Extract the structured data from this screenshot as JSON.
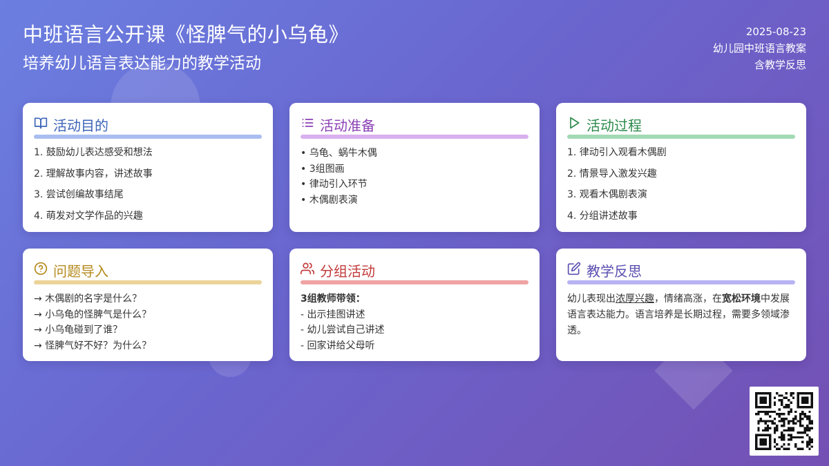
{
  "header": {
    "title": "中班语言公开课《怪脾气的小乌龟》",
    "subtitle": "培养幼儿语言表达能力的教学活动"
  },
  "meta": {
    "date": "2025-08-23",
    "line2": "幼儿园中班语言教案",
    "line3": "含教学反思"
  },
  "colors": {
    "goal": "#3c63b8",
    "prep": "#8a3fb5",
    "process": "#2a8a4a",
    "question": "#b58a1e",
    "group": "#c23a3a",
    "reflect": "#5a4fb0"
  },
  "cards": {
    "goal": {
      "icon": "book-open-icon",
      "title": "活动目的",
      "items": [
        "1. 鼓励幼儿表达感受和想法",
        "2. 理解故事内容，讲述故事",
        "3. 尝试创编故事结尾",
        "4. 萌发对文学作品的兴趣"
      ]
    },
    "prep": {
      "icon": "list-icon",
      "title": "活动准备",
      "items": [
        "• 乌龟、蜗牛木偶",
        "• 3组图画",
        "• 律动引入环节",
        "• 木偶剧表演"
      ]
    },
    "process": {
      "icon": "play-icon",
      "title": "活动过程",
      "items": [
        "1. 律动引入观看木偶剧",
        "2. 情景导入激发兴趣",
        "3. 观看木偶剧表演",
        "4. 分组讲述故事"
      ]
    },
    "question": {
      "icon": "question-circle-icon",
      "title": "问题导入",
      "items": [
        "→ 木偶剧的名字是什么？",
        "→ 小乌龟的怪脾气是什么？",
        "→ 小乌龟碰到了谁？",
        "→ 怪脾气好不好？为什么？"
      ]
    },
    "group": {
      "icon": "users-icon",
      "title": "分组活动",
      "lead": "3组教师带领：",
      "items": [
        "- 出示挂图讲述",
        "- 幼儿尝试自己讲述",
        "- 回家讲给父母听"
      ]
    },
    "reflect": {
      "icon": "edit-icon",
      "title": "教学反思",
      "text1": "幼儿表现出",
      "text2": "浓厚兴趣",
      "text3": "，情绪高涨，在",
      "text4": "宽松环境",
      "text5": "中发展语言表达能力。语言培养是长期过程，需要多领域渗透。"
    }
  },
  "qr": {
    "icon": "qr-code-icon"
  }
}
